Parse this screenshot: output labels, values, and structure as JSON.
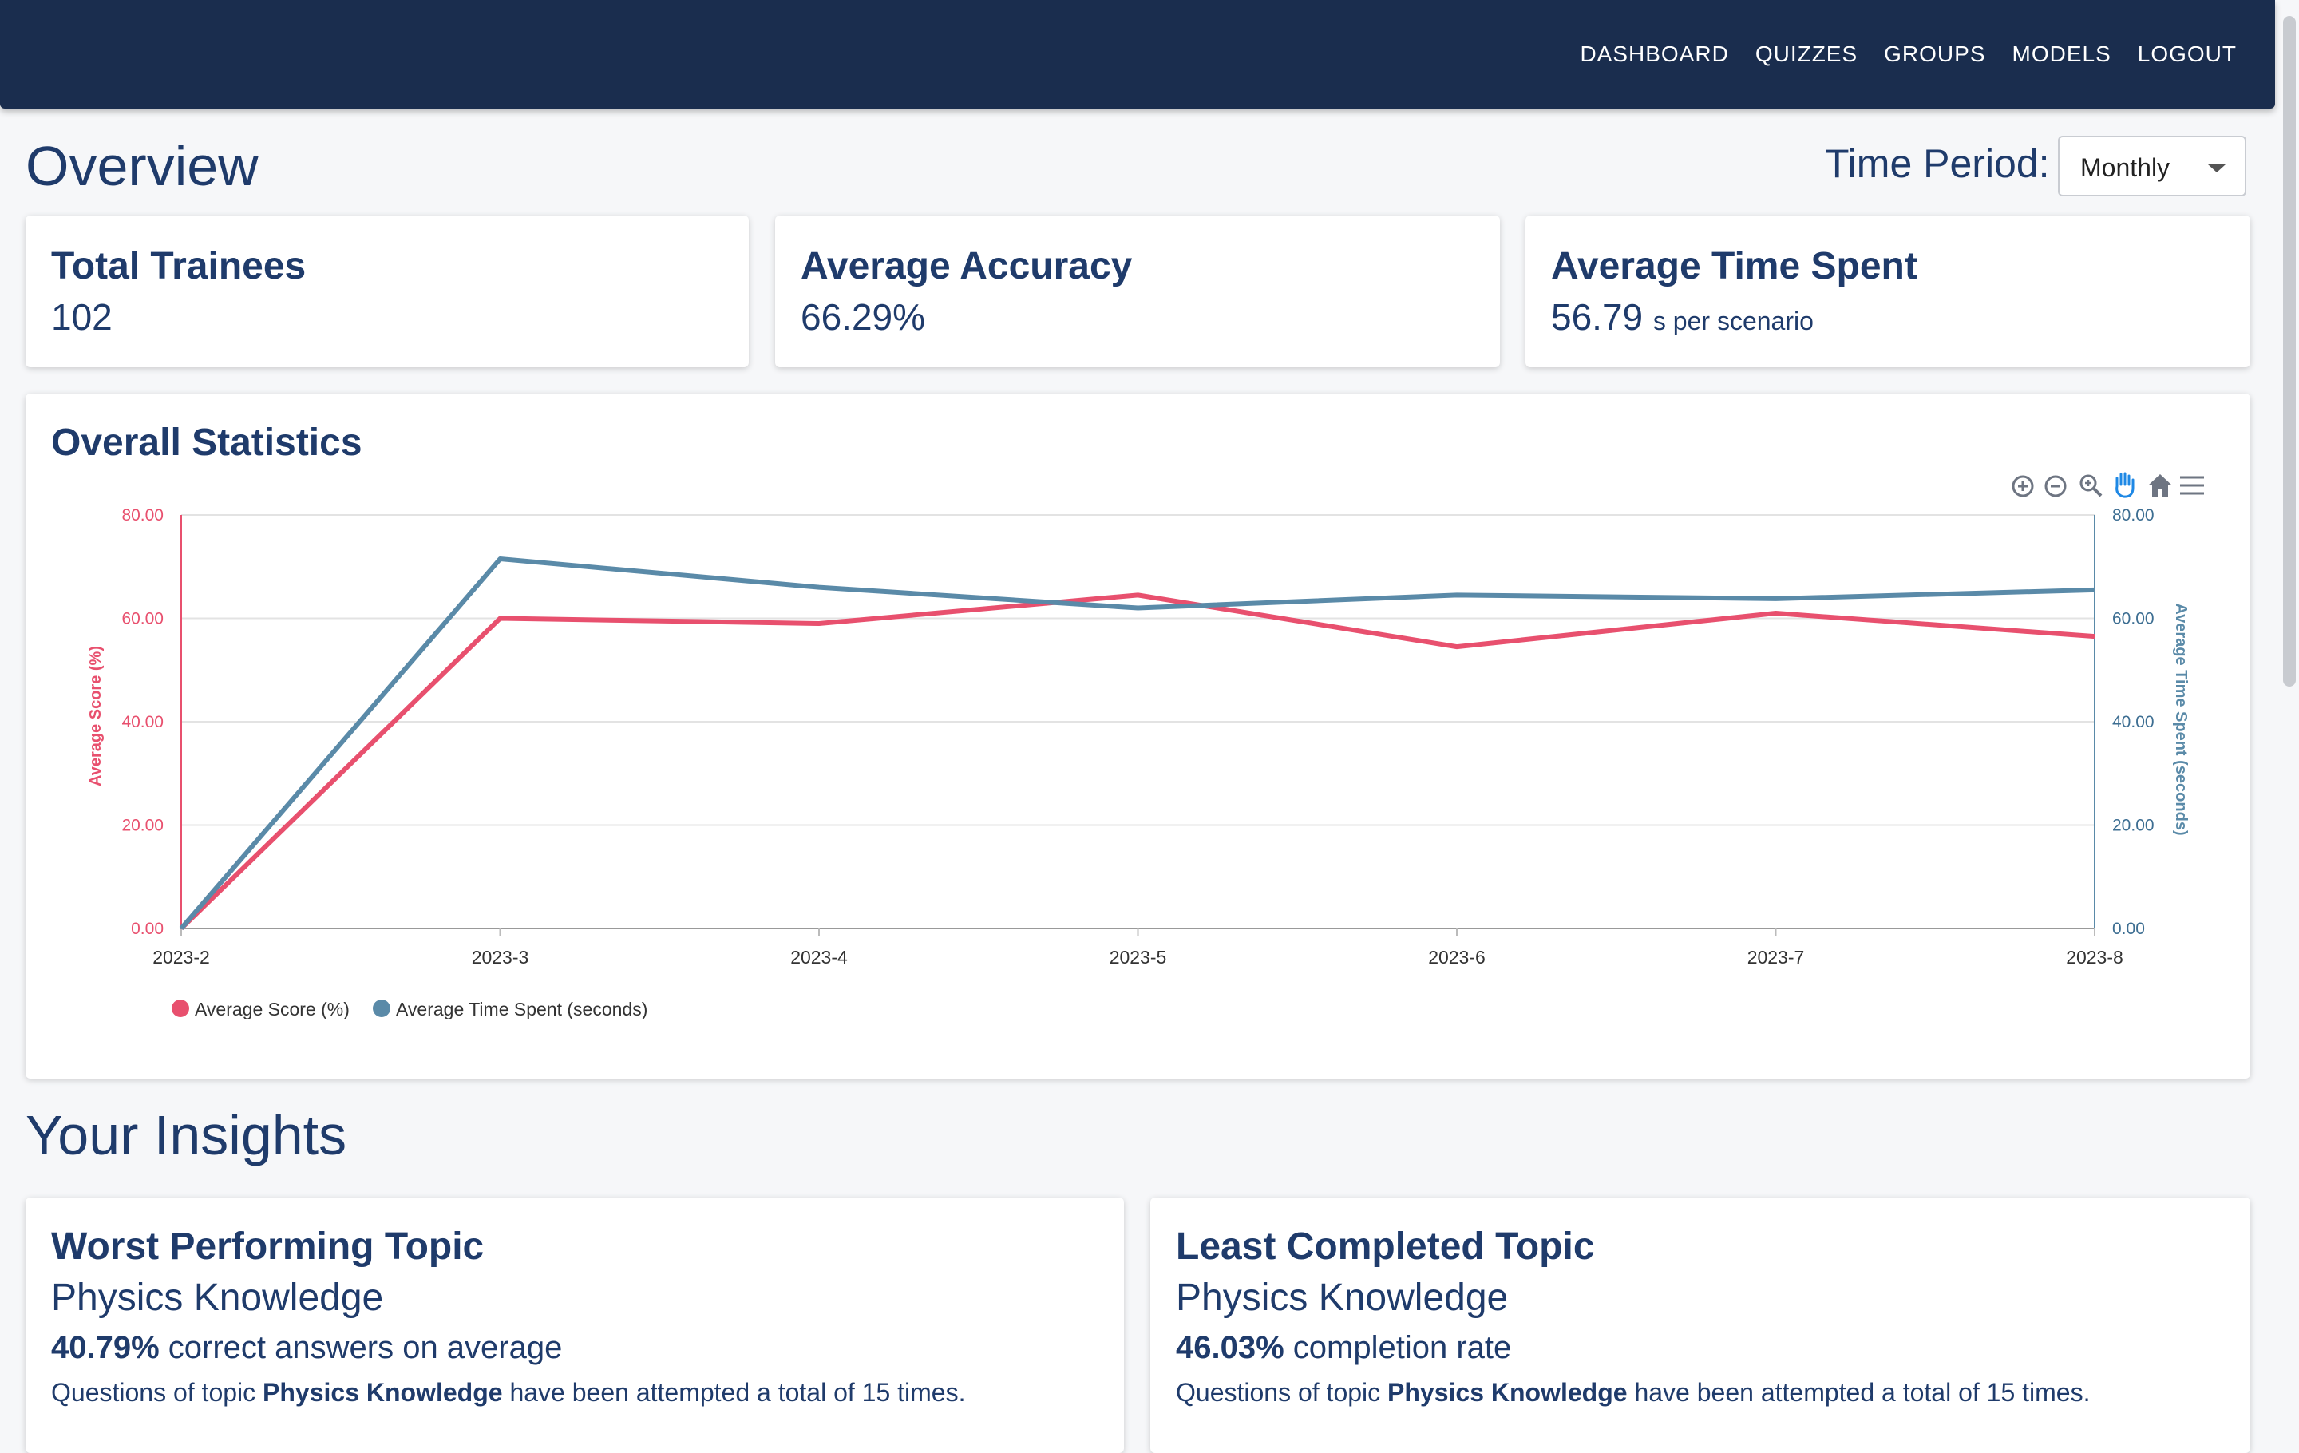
{
  "nav": {
    "items": [
      {
        "label": "DASHBOARD"
      },
      {
        "label": "QUIZZES"
      },
      {
        "label": "GROUPS"
      },
      {
        "label": "MODELS"
      },
      {
        "label": "LOGOUT"
      }
    ]
  },
  "overview": {
    "title": "Overview",
    "time_period_label": "Time Period:",
    "time_period_value": "Monthly"
  },
  "stats": {
    "total_trainees": {
      "title": "Total Trainees",
      "value": "102"
    },
    "avg_accuracy": {
      "title": "Average Accuracy",
      "value": "66.29%"
    },
    "avg_time": {
      "title": "Average Time Spent",
      "value": "56.79",
      "unit": "s per scenario"
    }
  },
  "overall": {
    "title": "Overall Statistics",
    "toolbar_icons": [
      "zoom-in-icon",
      "zoom-out-icon",
      "selection-zoom-icon",
      "pan-hand-icon",
      "home-reset-icon",
      "menu-icon"
    ]
  },
  "chart_data": {
    "type": "line",
    "categories": [
      "2023-2",
      "2023-3",
      "2023-4",
      "2023-5",
      "2023-6",
      "2023-7",
      "2023-8"
    ],
    "series": [
      {
        "name": "Average Score (%)",
        "color": "#e8506e",
        "axis": "left",
        "values": [
          0,
          60,
          59,
          64.5,
          54.5,
          61,
          56.5
        ]
      },
      {
        "name": "Average Time Spent (seconds)",
        "color": "#5a8aa8",
        "axis": "right",
        "values": [
          0,
          71.5,
          66,
          62,
          64.5,
          63.8,
          65.5
        ]
      }
    ],
    "ylabel_left": "Average Score (%)",
    "ylabel_right": "Average Time Spent (seconds)",
    "ylim": [
      0,
      80
    ],
    "y_ticks": [
      "0.00",
      "20.00",
      "40.00",
      "60.00",
      "80.00"
    ],
    "grid": true,
    "legend": "bottom-left"
  },
  "insights": {
    "title": "Your Insights",
    "worst": {
      "title": "Worst Performing Topic",
      "topic": "Physics Knowledge",
      "value": "40.79%",
      "value_suffix": " correct answers on average",
      "detail_prefix": "Questions of topic ",
      "detail_topic": "Physics Knowledge",
      "detail_suffix": " have been attempted a total of 15 times."
    },
    "least": {
      "title": "Least Completed Topic",
      "topic": "Physics Knowledge",
      "value": "46.03%",
      "value_suffix": " completion rate",
      "detail_prefix": "Questions of topic ",
      "detail_topic": "Physics Knowledge",
      "detail_suffix": " have been attempted a total of 15 times."
    }
  }
}
